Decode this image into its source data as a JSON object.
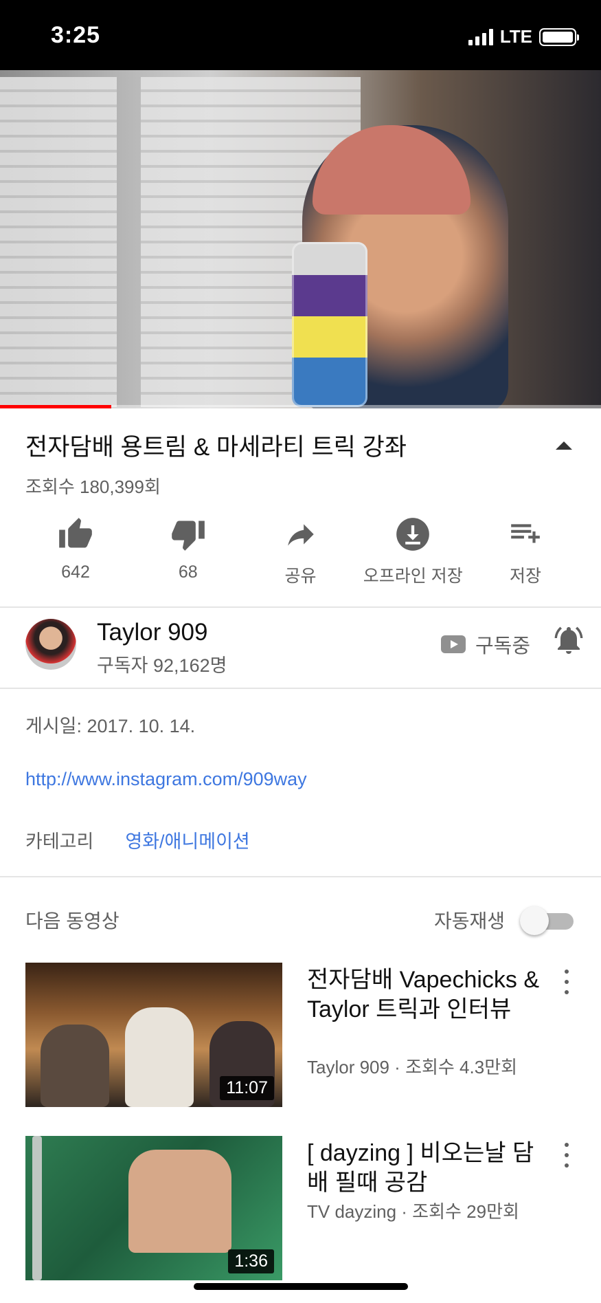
{
  "status_bar": {
    "time": "3:25",
    "network": "LTE"
  },
  "player": {
    "progress_percent": 18.5
  },
  "video": {
    "title": "전자담배 용트림 & 마세라티 트릭 강좌",
    "views": "조회수 180,399회"
  },
  "actions": {
    "like": "642",
    "dislike": "68",
    "share": "공유",
    "offline_save": "오프라인 저장",
    "save": "저장"
  },
  "channel": {
    "name": "Taylor 909",
    "subscribers": "구독자 92,162명",
    "subscribed_label": "구독중"
  },
  "description": {
    "published": "게시일: 2017. 10. 14.",
    "link": "http://www.instagram.com/909way",
    "category_label": "카테고리",
    "category_value": "영화/애니메이션"
  },
  "up_next": {
    "title": "다음 동영상",
    "autoplay_label": "자동재생",
    "autoplay_on": false,
    "items": [
      {
        "title": "전자담배 Vapechicks & Taylor 트릭과 인터뷰",
        "meta": "Taylor 909 · 조회수 4.3만회",
        "duration": "11:07"
      },
      {
        "title": "[ dayzing ] 비오는날 담배 필때 공감",
        "meta": "TV dayzing · 조회수 29만회",
        "duration": "1:36"
      }
    ]
  },
  "colors": {
    "accent_red": "#ff0000",
    "link_blue": "#3e77e0",
    "secondary_text": "#606060"
  }
}
